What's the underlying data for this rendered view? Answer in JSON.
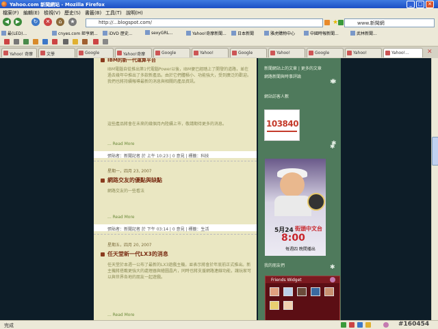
{
  "window": {
    "title": "Yahoo.com 新聞網站 - Mozilla Firefox",
    "minimize": "_",
    "maximize": "□",
    "close": "✕"
  },
  "menu": [
    "檔案(F)",
    "編輯(E)",
    "檢視(V)",
    "歷史(S)",
    "書籤(B)",
    "工具(T)",
    "說明(H)"
  ],
  "nav": {
    "url": "http://...blogspot.com/",
    "search_value": "www.新聞網"
  },
  "bookmarks": [
    "最(LED)...",
    "cnyes.com 鉅亨網...",
    "iDVD 歷史...",
    "sexyGRL...",
    "Yahoo!奇摩新聞...",
    "日本新聞",
    "雅虎購物中心",
    "中國時報新聞...",
    "武林新聞..."
  ],
  "tabs": [
    "Yahoo! 奇摩",
    "文學",
    "Google",
    "Yahoo!奇摩",
    "Google",
    "Yahoo!",
    "Google",
    "Yahoo!",
    "Google",
    "Yahoo!",
    "Yahoo!..."
  ],
  "posts": {
    "top_heading": "IBM的新一代運算平台",
    "top_paragraph": "IBM電腦自從推出第1代電腦Power以後，IBM便已經踏上了開發的道路，並在過去幾年中推出了多款新產品。由於它們體積小、功能強大，受到廣泛的歡迎。我們也將持續報導最新的消息與相關的產品資訊。",
    "top_paragraph2": "這些產品將會在未來的幾個月內陸續上市，敬請期待更多的消息。",
    "readmore1": "... Read More",
    "footer1": "張貼者：新聞記者 於 上午 10:23 | 0 意見 | 標籤：科技",
    "date2": "星期一，四月 23, 2007",
    "title2": "網路交友的優點與缺點",
    "excerpt2": "網路交友的一些看法",
    "readmore2": "... Read More",
    "footer2": "張貼者：新聞記者 於 下午 03:14 | 0 意見 | 標籤：生活",
    "date3": "星期五，四月 20, 2007",
    "title3": "任天堂新一代LX3的消息",
    "paragraph3": "任天堂於本週一公布了最新的LX3遊戲主機，並表示將會於年底前正式推出。新主機將搭載更強大的處理器與繪圖晶片，同時也將支援網路連線功能，讓玩家可以與世界各地的朋友一起遊戲。",
    "readmore3": "... Read More"
  },
  "sidebar": {
    "top_text": "新聞網站上的文章 | 更多的文章",
    "top_text2": "網路新聞與時事評論",
    "counter_title": "網站訪客人數",
    "counter_value": "103840",
    "promo": {
      "date": "5月24",
      "channel": "街頭中文台",
      "time": "8:00",
      "sub": "每週四 晚間播出"
    },
    "friends_title": "Friends Widget",
    "section_label": "我的朋友們"
  },
  "status": {
    "text": "完成",
    "watermark": "#160454"
  }
}
